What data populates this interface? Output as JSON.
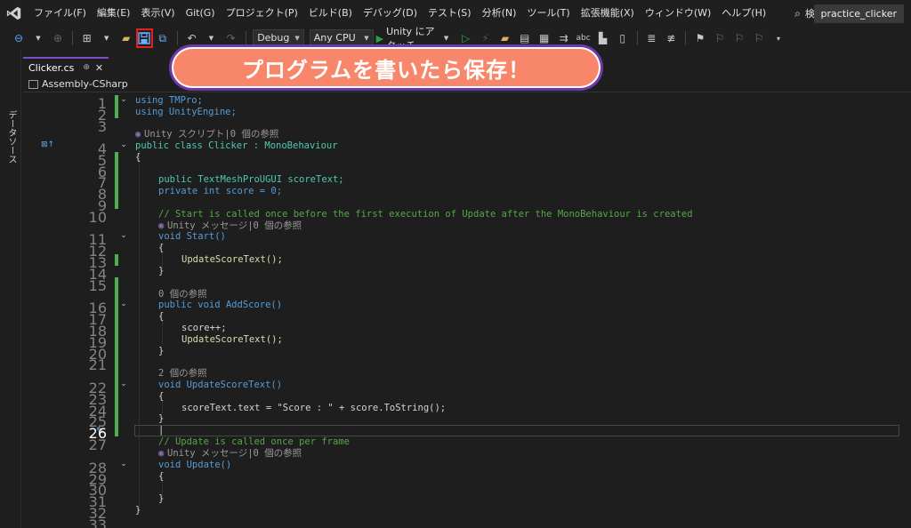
{
  "menubar": {
    "items": [
      "ファイル(F)",
      "編集(E)",
      "表示(V)",
      "Git(G)",
      "プロジェクト(P)",
      "ビルド(B)",
      "デバッグ(D)",
      "テスト(S)",
      "分析(N)",
      "ツール(T)",
      "拡張機能(X)",
      "ウィンドウ(W)",
      "ヘルプ(H)"
    ],
    "search_label": "検索",
    "project_name": "practice_clicker"
  },
  "toolbar": {
    "config": "Debug",
    "platform": "Any CPU",
    "run_label": "Unity にアタッチ"
  },
  "callout": {
    "text": "プログラムを書いたら保存！"
  },
  "sidebar": {
    "label": "データソース"
  },
  "tab": {
    "filename": "Clicker.cs",
    "pin": "⊕",
    "close": "✕"
  },
  "navbar": {
    "project": "Assembly-CSharp"
  },
  "code": {
    "line_01": "using TMPro;",
    "line_02": "using UnityEngine;",
    "lens_03": "Unity スクリプト|0 個の参照",
    "line_04": "public class Clicker : MonoBehaviour",
    "line_05": "{",
    "line_07": "public TextMeshProUGUI scoreText;",
    "line_08": "private int score = 0;",
    "line_10": "// Start is called once before the first execution of Update after the MonoBehaviour is created",
    "lens_10": "Unity メッセージ|0 個の参照",
    "line_11": "void Start()",
    "line_12": "{",
    "line_13": "UpdateScoreText();",
    "line_14": "}",
    "lens_15": "0 個の参照",
    "line_16": "public void AddScore()",
    "line_17": "{",
    "line_18": "score++;",
    "line_19": "UpdateScoreText();",
    "line_20": "}",
    "lens_21": "2 個の参照",
    "line_22": "void UpdateScoreText()",
    "line_23": "{",
    "line_24": "scoreText.text = \"Score : \" + score.ToString();",
    "line_25": "}",
    "line_26": "|",
    "line_27": "// Update is called once per frame",
    "lens_27": "Unity メッセージ|0 個の参照",
    "line_28": "void Update()",
    "line_29": "{",
    "line_31": "}",
    "line_32": "}",
    "line_numbers": [
      "1",
      "2",
      "3",
      "4",
      "5",
      "6",
      "7",
      "8",
      "9",
      "10",
      "11",
      "12",
      "13",
      "14",
      "15",
      "16",
      "17",
      "18",
      "19",
      "20",
      "21",
      "22",
      "23",
      "24",
      "25",
      "26",
      "27",
      "28",
      "29",
      "30",
      "31",
      "32",
      "33"
    ]
  },
  "colors": {
    "callout_bg": "#f8866a",
    "callout_border": "#6a3aa8",
    "highlight_box": "#e81f1f",
    "change_bar": "#4caf50"
  }
}
